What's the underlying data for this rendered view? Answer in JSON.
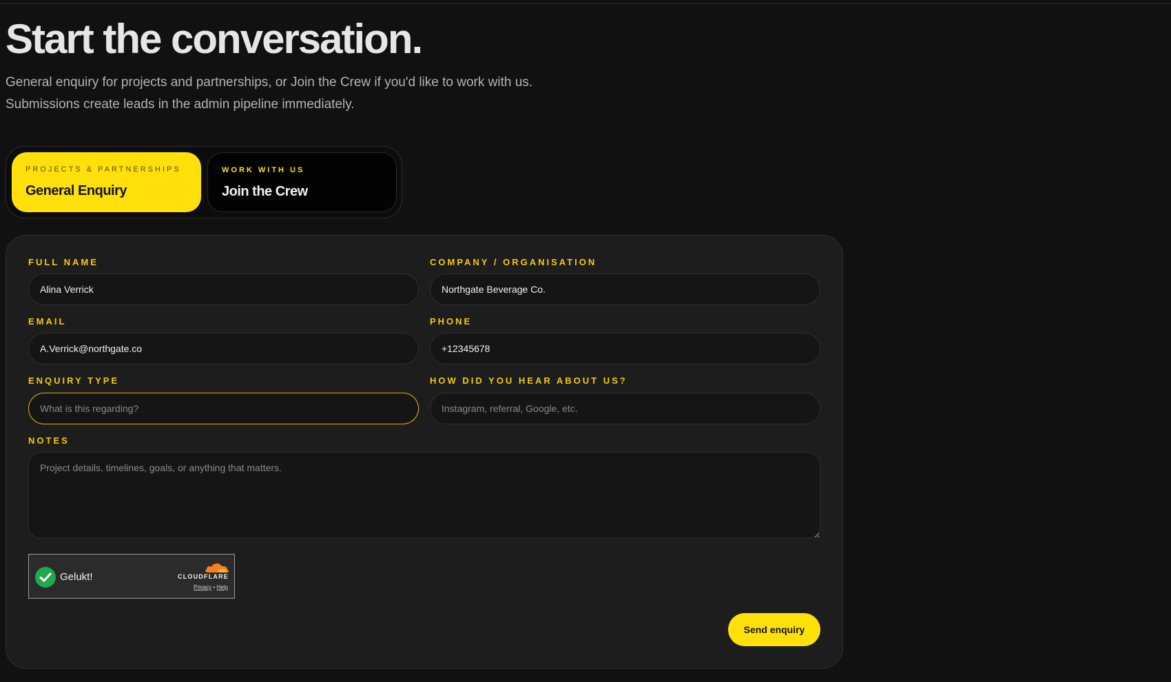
{
  "hero": {
    "title": "Start the conversation.",
    "subtitle_line1": "General enquiry for projects and partnerships, or Join the Crew if you'd like to work with us.",
    "subtitle_line2": "Submissions create leads in the admin pipeline immediately."
  },
  "tabs": [
    {
      "kicker": "PROJECTS & PARTNERSHIPS",
      "label": "General Enquiry",
      "active": true
    },
    {
      "kicker": "WORK WITH US",
      "label": "Join the Crew",
      "active": false
    }
  ],
  "form": {
    "full_name": {
      "label": "FULL NAME",
      "value": "Alina Verrick",
      "placeholder": ""
    },
    "company": {
      "label": "COMPANY / ORGANISATION",
      "value": "Northgate Beverage Co.",
      "placeholder": ""
    },
    "email": {
      "label": "EMAIL",
      "value": "A.Verrick@northgate.co",
      "placeholder": ""
    },
    "phone": {
      "label": "PHONE",
      "value": "+12345678",
      "placeholder": ""
    },
    "enquiry_type": {
      "label": "ENQUIRY TYPE",
      "value": "",
      "placeholder": "What is this regarding?"
    },
    "referral": {
      "label": "HOW DID YOU HEAR ABOUT US?",
      "value": "",
      "placeholder": "Instagram, referral, Google, etc."
    },
    "notes": {
      "label": "NOTES",
      "value": "",
      "placeholder": "Project details, timelines, goals, or anything that matters."
    },
    "submit_label": "Send enquiry"
  },
  "turnstile": {
    "status": "Gelukt!",
    "brand": "CLOUDFLARE",
    "privacy": "Privacy",
    "separator": "•",
    "help": "Help"
  },
  "colors": {
    "accent": "#ffe00a",
    "label": "#f2cc0a",
    "background": "#111111",
    "card": "#1d1d1d",
    "success": "#22a84f",
    "cloudflare_orange": "#f48120"
  }
}
